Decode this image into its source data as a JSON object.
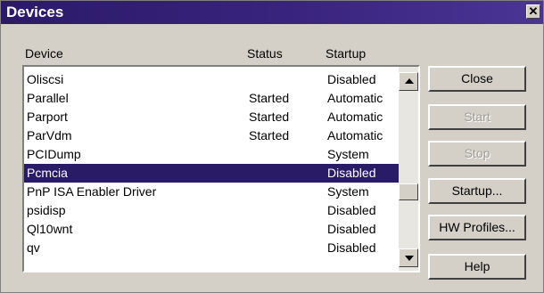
{
  "window": {
    "title": "Devices",
    "close_glyph": "✕"
  },
  "columns": {
    "device": "Device",
    "status": "Status",
    "startup": "Startup"
  },
  "rows": [
    {
      "name": "Oliscsi",
      "status": "",
      "startup": "Disabled"
    },
    {
      "name": "Parallel",
      "status": "Started",
      "startup": "Automatic"
    },
    {
      "name": "Parport",
      "status": "Started",
      "startup": "Automatic"
    },
    {
      "name": "ParVdm",
      "status": "Started",
      "startup": "Automatic"
    },
    {
      "name": "PCIDump",
      "status": "",
      "startup": "System"
    },
    {
      "name": "Pcmcia",
      "status": "",
      "startup": "Disabled",
      "selected": true
    },
    {
      "name": "PnP ISA Enabler Driver",
      "status": "",
      "startup": "System"
    },
    {
      "name": "psidisp",
      "status": "",
      "startup": "Disabled"
    },
    {
      "name": "Ql10wnt",
      "status": "",
      "startup": "Disabled"
    },
    {
      "name": "qv",
      "status": "",
      "startup": "Disabled"
    }
  ],
  "buttons": {
    "close": "Close",
    "start": "Start",
    "stop": "Stop",
    "startup": "Startup...",
    "hw_profiles": "HW Profiles...",
    "help": "Help"
  },
  "colors": {
    "title_bar": "#2b1a68",
    "selection": "#2a1b66",
    "face": "#d4d0c8"
  }
}
